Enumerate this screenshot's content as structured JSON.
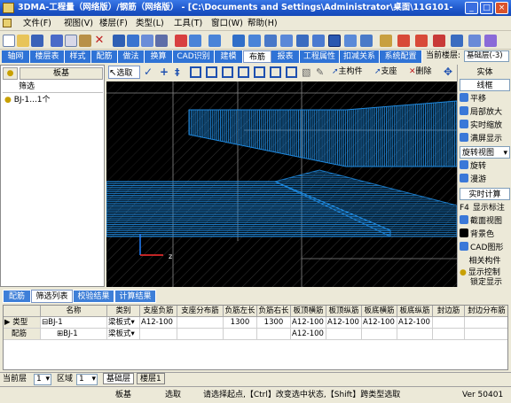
{
  "window": {
    "title": "3DMA-工程量（网络版）/钢筋（网络版） - [C:\\Documents and Settings\\Administrator\\桌面\\11G101-"
  },
  "menubar": [
    "文件(F)",
    "视图(V)",
    "楼层(F)",
    "类型(L)",
    "工具(T)",
    "窗口(W)",
    "帮助(H)"
  ],
  "tabs": [
    "轴网",
    "楼层表",
    "样式",
    "配筋",
    "做法",
    "换算",
    "CAD识别",
    "建模",
    "布筋",
    "报表",
    "工程属性",
    "扣减关系",
    "系统配置"
  ],
  "active_tab": "布筋",
  "floor": {
    "label": "当前楼层:",
    "value": "基础层(-3)"
  },
  "left_panel": {
    "title": "板基",
    "filter": "筛选",
    "item": "BJ-1...1个"
  },
  "toolbar2": {
    "select": "选取",
    "main_member": "主构件",
    "support": "支座",
    "delete": "删除"
  },
  "right_panel": {
    "title1": "实体",
    "mode": "线框",
    "items1": [
      "平移",
      "局部放大",
      "实时缩放",
      "满屏显示"
    ],
    "rotate_view": "旋转视图",
    "items2": [
      "旋转",
      "漫游"
    ],
    "realtime_calc": "实时计算",
    "f4_label": "F4",
    "items3": [
      "显示标注",
      "截面视图",
      "背景色",
      "CAD图形"
    ],
    "title2": "相关构件",
    "items4": [
      "显示控制",
      "锁定显示"
    ]
  },
  "bottom_tabs": [
    "配筋",
    "筛选列表",
    "校验结果",
    "计算结果"
  ],
  "active_bottom_tab": "筛选列表",
  "grid": {
    "headers": [
      "名称",
      "类别",
      "支座负筋",
      "支座分布筋",
      "负筋左长",
      "负筋右长",
      "板顶横筋",
      "板顶纵筋",
      "板底横筋",
      "板底纵筋",
      "封边筋",
      "封边分布筋"
    ],
    "rows": [
      {
        "type": "类型",
        "name": "BJ-1",
        "cells": [
          "梁板式",
          "A12-100",
          "",
          "1300",
          "1300",
          "A12-100",
          "A12-100",
          "A12-100",
          "A12-100",
          "",
          ""
        ]
      },
      {
        "type": "配筋",
        "name": "BJ-1",
        "cells": [
          "梁板式",
          "",
          "",
          "",
          "",
          "A12-100",
          "",
          "",
          "",
          "",
          ""
        ]
      }
    ]
  },
  "bottom_bar": {
    "floor_label": "当前层",
    "floor_value": "1",
    "zone_label": "区域",
    "zone_value": "1",
    "floor_tabs": [
      "基础层",
      "楼层1"
    ]
  },
  "statusbar": {
    "component": "板基",
    "mode": "选取",
    "hint": "请选择起点,【Ctrl】改变选中状态,【Shift】跨类型选取",
    "version": "Ver 50401"
  }
}
